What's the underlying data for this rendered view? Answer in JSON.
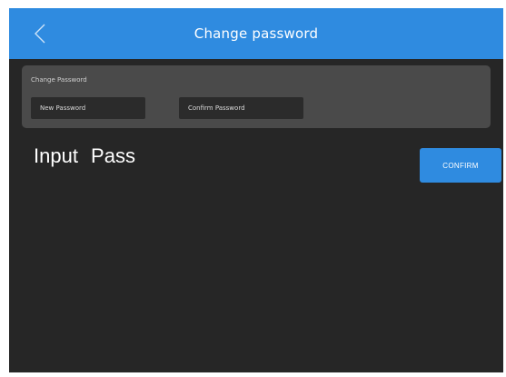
{
  "header": {
    "title": "Change password",
    "back_icon": "chevron-left-icon"
  },
  "panel": {
    "label": "Change Password",
    "new_password_placeholder": "New Password",
    "confirm_password_placeholder": "Confirm Password"
  },
  "main": {
    "prompt_text": "Input  Pass",
    "confirm_label": "CONFIRM"
  },
  "colors": {
    "accent": "#2f8be0",
    "background": "#262626",
    "panel": "#4a4a4a"
  }
}
